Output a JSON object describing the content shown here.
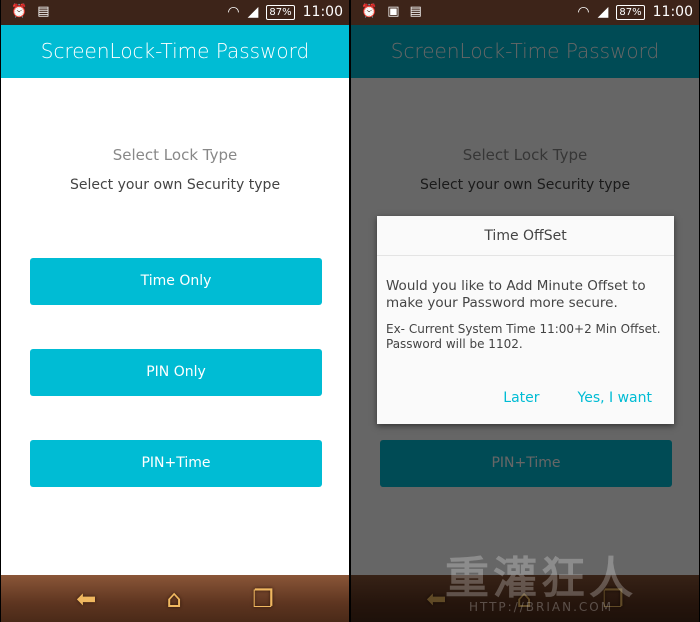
{
  "status": {
    "time": "11:00",
    "battery": "87%"
  },
  "app": {
    "title": "ScreenLock-Time Password",
    "heading": "Select Lock Type",
    "subheading": "Select your own Security type",
    "buttons": [
      "Time Only",
      "PIN Only",
      "PIN+Time"
    ]
  },
  "dialog": {
    "title": "Time OffSet",
    "message": "Would you like to Add Minute Offset to make your Password more secure.",
    "example": "Ex- Current System Time 11:00+2 Min Offset. Password will be 1102.",
    "later": "Later",
    "confirm": "Yes, I want"
  },
  "nav": {
    "icons": [
      "back-icon",
      "home-icon",
      "recent-apps-icon"
    ]
  },
  "watermark": {
    "text": "重灌狂人",
    "url": "HTTP://BRIAN.COM"
  },
  "colors": {
    "accent": "#00bcd4",
    "status_bar": "#3d2419"
  }
}
